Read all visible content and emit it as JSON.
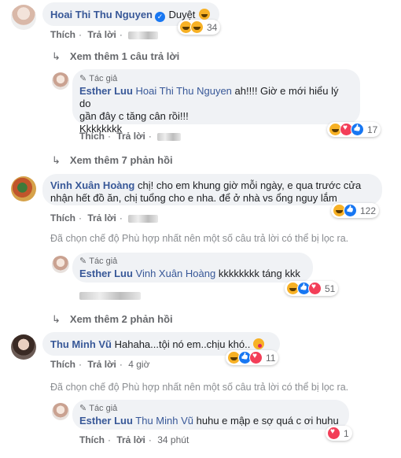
{
  "comments": [
    {
      "author": "Hoai Thi Thu Nguyen",
      "verified": true,
      "text": "Duyệt",
      "actions": {
        "like": "Thích",
        "reply": "Trả lời"
      },
      "reaction_count": "34",
      "view_more": "Xem thêm 1 câu trả lời",
      "reply": {
        "badge": "Tác giả",
        "author": "Esther Luu",
        "mention": "Hoai Thi Thu Nguyen",
        "text_line1": "ah!!!! Giờ e mới hiểu lý do",
        "text_line2": "gần đây c tăng cân rồi!!!",
        "text_line3": "Kkkkkkkk",
        "actions": {
          "like": "Thích",
          "reply": "Trả lời"
        },
        "reaction_count": "17"
      },
      "view_more_2": "Xem thêm 7 phản hồi"
    },
    {
      "author": "Vinh Xuân Hoàng",
      "text_line1": "chị! cho em khung giờ mỗi ngày, e qua trước cửa",
      "text_line2": "nhận hết đồ ăn, chị tuổng cho e nha. để ở nhà vs ổng nguy lắm",
      "actions": {
        "like": "Thích",
        "reply": "Trả lời"
      },
      "reaction_count": "122",
      "notice": "Đã chọn chế độ Phù hợp nhất nên một số câu trả lời có thể bị lọc ra.",
      "reply": {
        "badge": "Tác giả",
        "author": "Esther Luu",
        "mention": "Vinh Xuân Hoàng",
        "text": "kkkkkkkk táng kkk",
        "reaction_count": "51"
      },
      "view_more": "Xem thêm 2 phản hồi"
    },
    {
      "author": "Thu Minh Vũ",
      "text": "Hahaha...tội nó em..chịu khó..",
      "actions": {
        "like": "Thích",
        "reply": "Trả lời",
        "time": "4 giờ"
      },
      "reaction_count": "11",
      "notice": "Đã chọn chế độ Phù hợp nhất nên một số câu trả lời có thể bị lọc ra.",
      "reply": {
        "badge": "Tác giả",
        "author": "Esther Luu",
        "mention": "Thu Minh Vũ",
        "text": "huhu e mập e sợ quá c ơi huhu",
        "actions": {
          "like": "Thích",
          "reply": "Trả lời",
          "time": "34 phút"
        },
        "reaction_count": "1"
      }
    }
  ],
  "colors": {
    "name": "#385898",
    "bubble": "#f0f2f5",
    "meta": "#65676b",
    "notice": "#8a8d91",
    "like": "#1877f2",
    "love": "#f33e58",
    "haha": "#f7b125"
  }
}
